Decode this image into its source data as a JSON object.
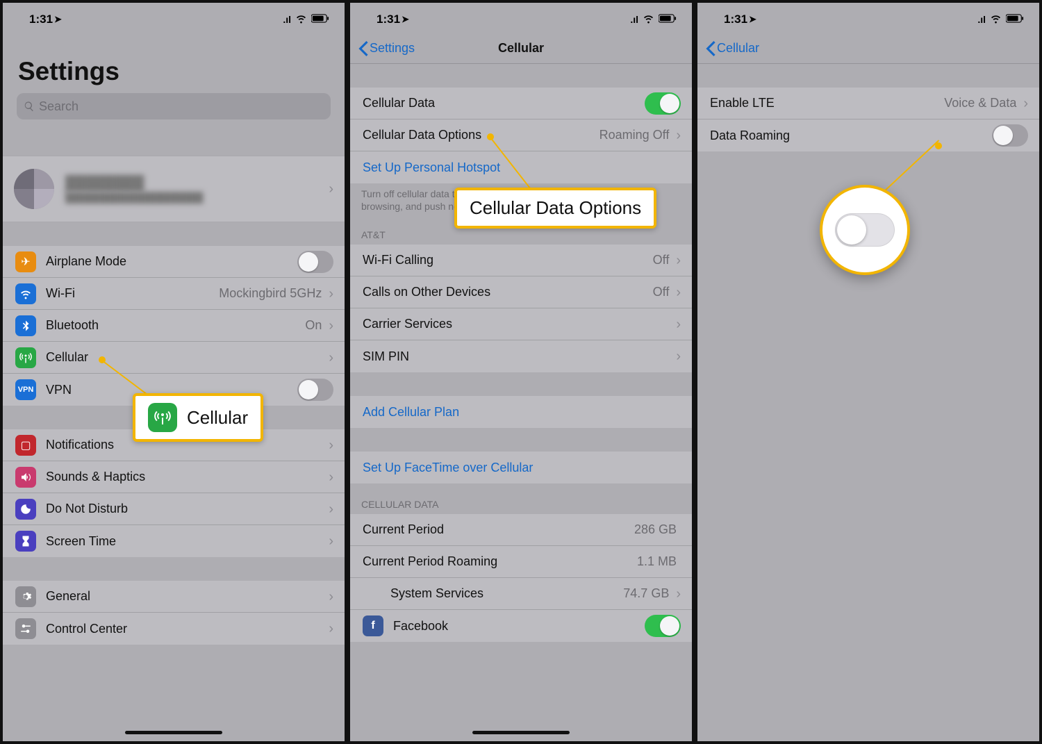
{
  "status": {
    "time": "1:31"
  },
  "panel1": {
    "title": "Settings",
    "search_placeholder": "Search",
    "profile": {
      "name": "████████",
      "sub": "████████████████████"
    },
    "rows": {
      "airplane": "Airplane Mode",
      "wifi": "Wi-Fi",
      "wifi_val": "Mockingbird 5GHz",
      "bluetooth": "Bluetooth",
      "bluetooth_val": "On",
      "cellular": "Cellular",
      "vpn": "VPN",
      "notifications": "Notifications",
      "sounds": "Sounds & Haptics",
      "dnd": "Do Not Disturb",
      "screentime": "Screen Time",
      "general": "General",
      "controlcenter": "Control Center"
    },
    "callout": "Cellular"
  },
  "panel2": {
    "back": "Settings",
    "title": "Cellular",
    "rows": {
      "cellular_data": "Cellular Data",
      "options": "Cellular Data Options",
      "options_val": "Roaming Off",
      "hotspot": "Set Up Personal Hotspot",
      "footer": "Turn off cellular data to restrict all data to Wi-Fi, including email, web browsing, and push notifications.",
      "section_carrier": "AT&T",
      "wificalling": "Wi-Fi Calling",
      "wificalling_val": "Off",
      "otherdevices": "Calls on Other Devices",
      "otherdevices_val": "Off",
      "carrierservices": "Carrier Services",
      "simpin": "SIM PIN",
      "addplan": "Add Cellular Plan",
      "facetime": "Set Up FaceTime over Cellular",
      "section_data": "CELLULAR DATA",
      "currentperiod": "Current Period",
      "currentperiod_val": "286 GB",
      "roamingperiod": "Current Period Roaming",
      "roamingperiod_val": "1.1 MB",
      "system": "System Services",
      "system_val": "74.7 GB",
      "facebook": "Facebook"
    },
    "callout": "Cellular Data Options"
  },
  "panel3": {
    "back": "Cellular",
    "rows": {
      "lte": "Enable LTE",
      "lte_val": "Voice & Data",
      "roaming": "Data Roaming"
    }
  }
}
